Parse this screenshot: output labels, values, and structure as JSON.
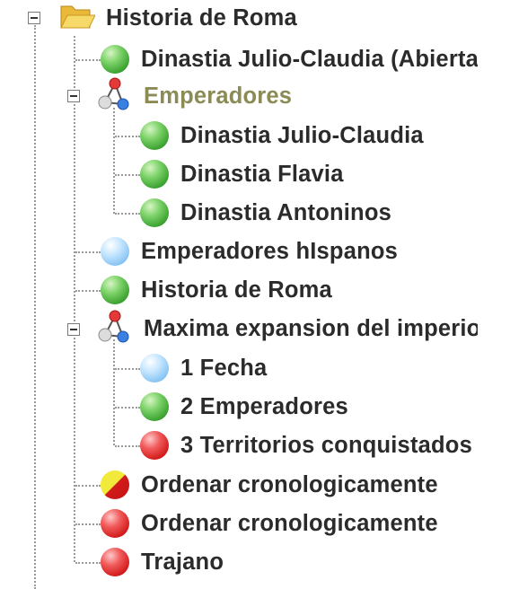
{
  "tree": {
    "root": {
      "label": "Historia de Roma",
      "icon": "open-folder-icon",
      "expanded": true
    },
    "items": [
      {
        "label": "Dinastia Julio-Claudia (Abierta)",
        "status": "green"
      },
      {
        "label": "Emperadores",
        "icon": "network-icon",
        "expanded": true,
        "highlight_color": "#8c8a55",
        "children": [
          {
            "label": "Dinastia Julio-Claudia",
            "status": "green"
          },
          {
            "label": "Dinastia Flavia",
            "status": "green"
          },
          {
            "label": "Dinastia Antoninos",
            "status": "green"
          }
        ]
      },
      {
        "label": "Emperadores hIspanos",
        "status": "blue"
      },
      {
        "label": "Historia de Roma",
        "status": "green"
      },
      {
        "label": "Maxima expansion del imperio",
        "icon": "network-icon",
        "expanded": true,
        "children": [
          {
            "label": "1 Fecha",
            "status": "blue"
          },
          {
            "label": "2 Emperadores",
            "status": "green"
          },
          {
            "label": "3 Territorios conquistados",
            "status": "red"
          }
        ]
      },
      {
        "label": "Ordenar cronologicamente",
        "status": "yellow-red"
      },
      {
        "label": "Ordenar cronologicamente",
        "status": "red"
      },
      {
        "label": "Trajano",
        "status": "red"
      }
    ]
  },
  "colors": {
    "green": "#3aa12f",
    "blue": "#7fc0f2",
    "red": "#d21a1a",
    "yellow": "#f2ea3a",
    "text": "#2b2b2b",
    "connector": "#9a9a9a"
  }
}
